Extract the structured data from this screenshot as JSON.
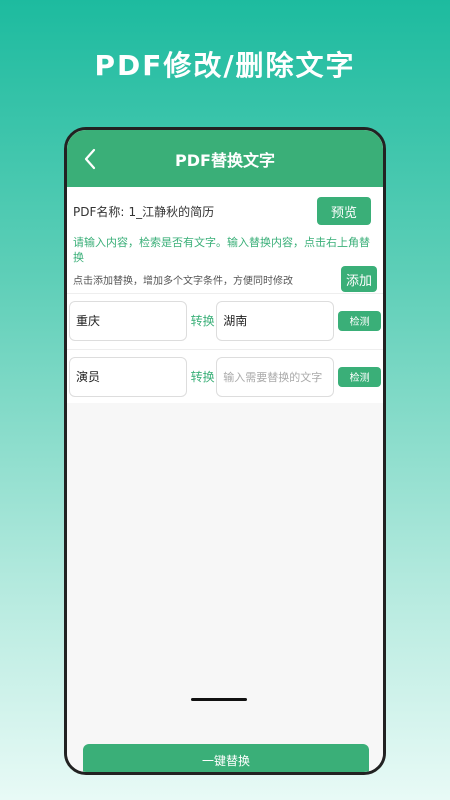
{
  "promo": {
    "title": "PDF修改/删除文字"
  },
  "header": {
    "title": "PDF替换文字",
    "back_icon": "chevron-left-icon"
  },
  "pdf": {
    "label": "PDF名称:",
    "value": "1_江静秋的简历",
    "preview_label": "预览"
  },
  "tips": {
    "green": "请输入内容，检索是否有文字。输入替换内容，点击右上角替换",
    "gray": "点击添加替换，增加多个文字条件，方便同时修改",
    "add_label": "添加"
  },
  "rules": [
    {
      "source": "重庆",
      "convert": "转换",
      "target": "湖南",
      "target_placeholder": "",
      "check_label": "检测"
    },
    {
      "source": "演员",
      "convert": "转换",
      "target": "",
      "target_placeholder": "输入需要替换的文字",
      "check_label": "检测"
    }
  ],
  "footer": {
    "replace_all_label": "一键替换"
  },
  "colors": {
    "accent": "#3aaf78",
    "promo_gradient_top": "#1dbb9f"
  }
}
